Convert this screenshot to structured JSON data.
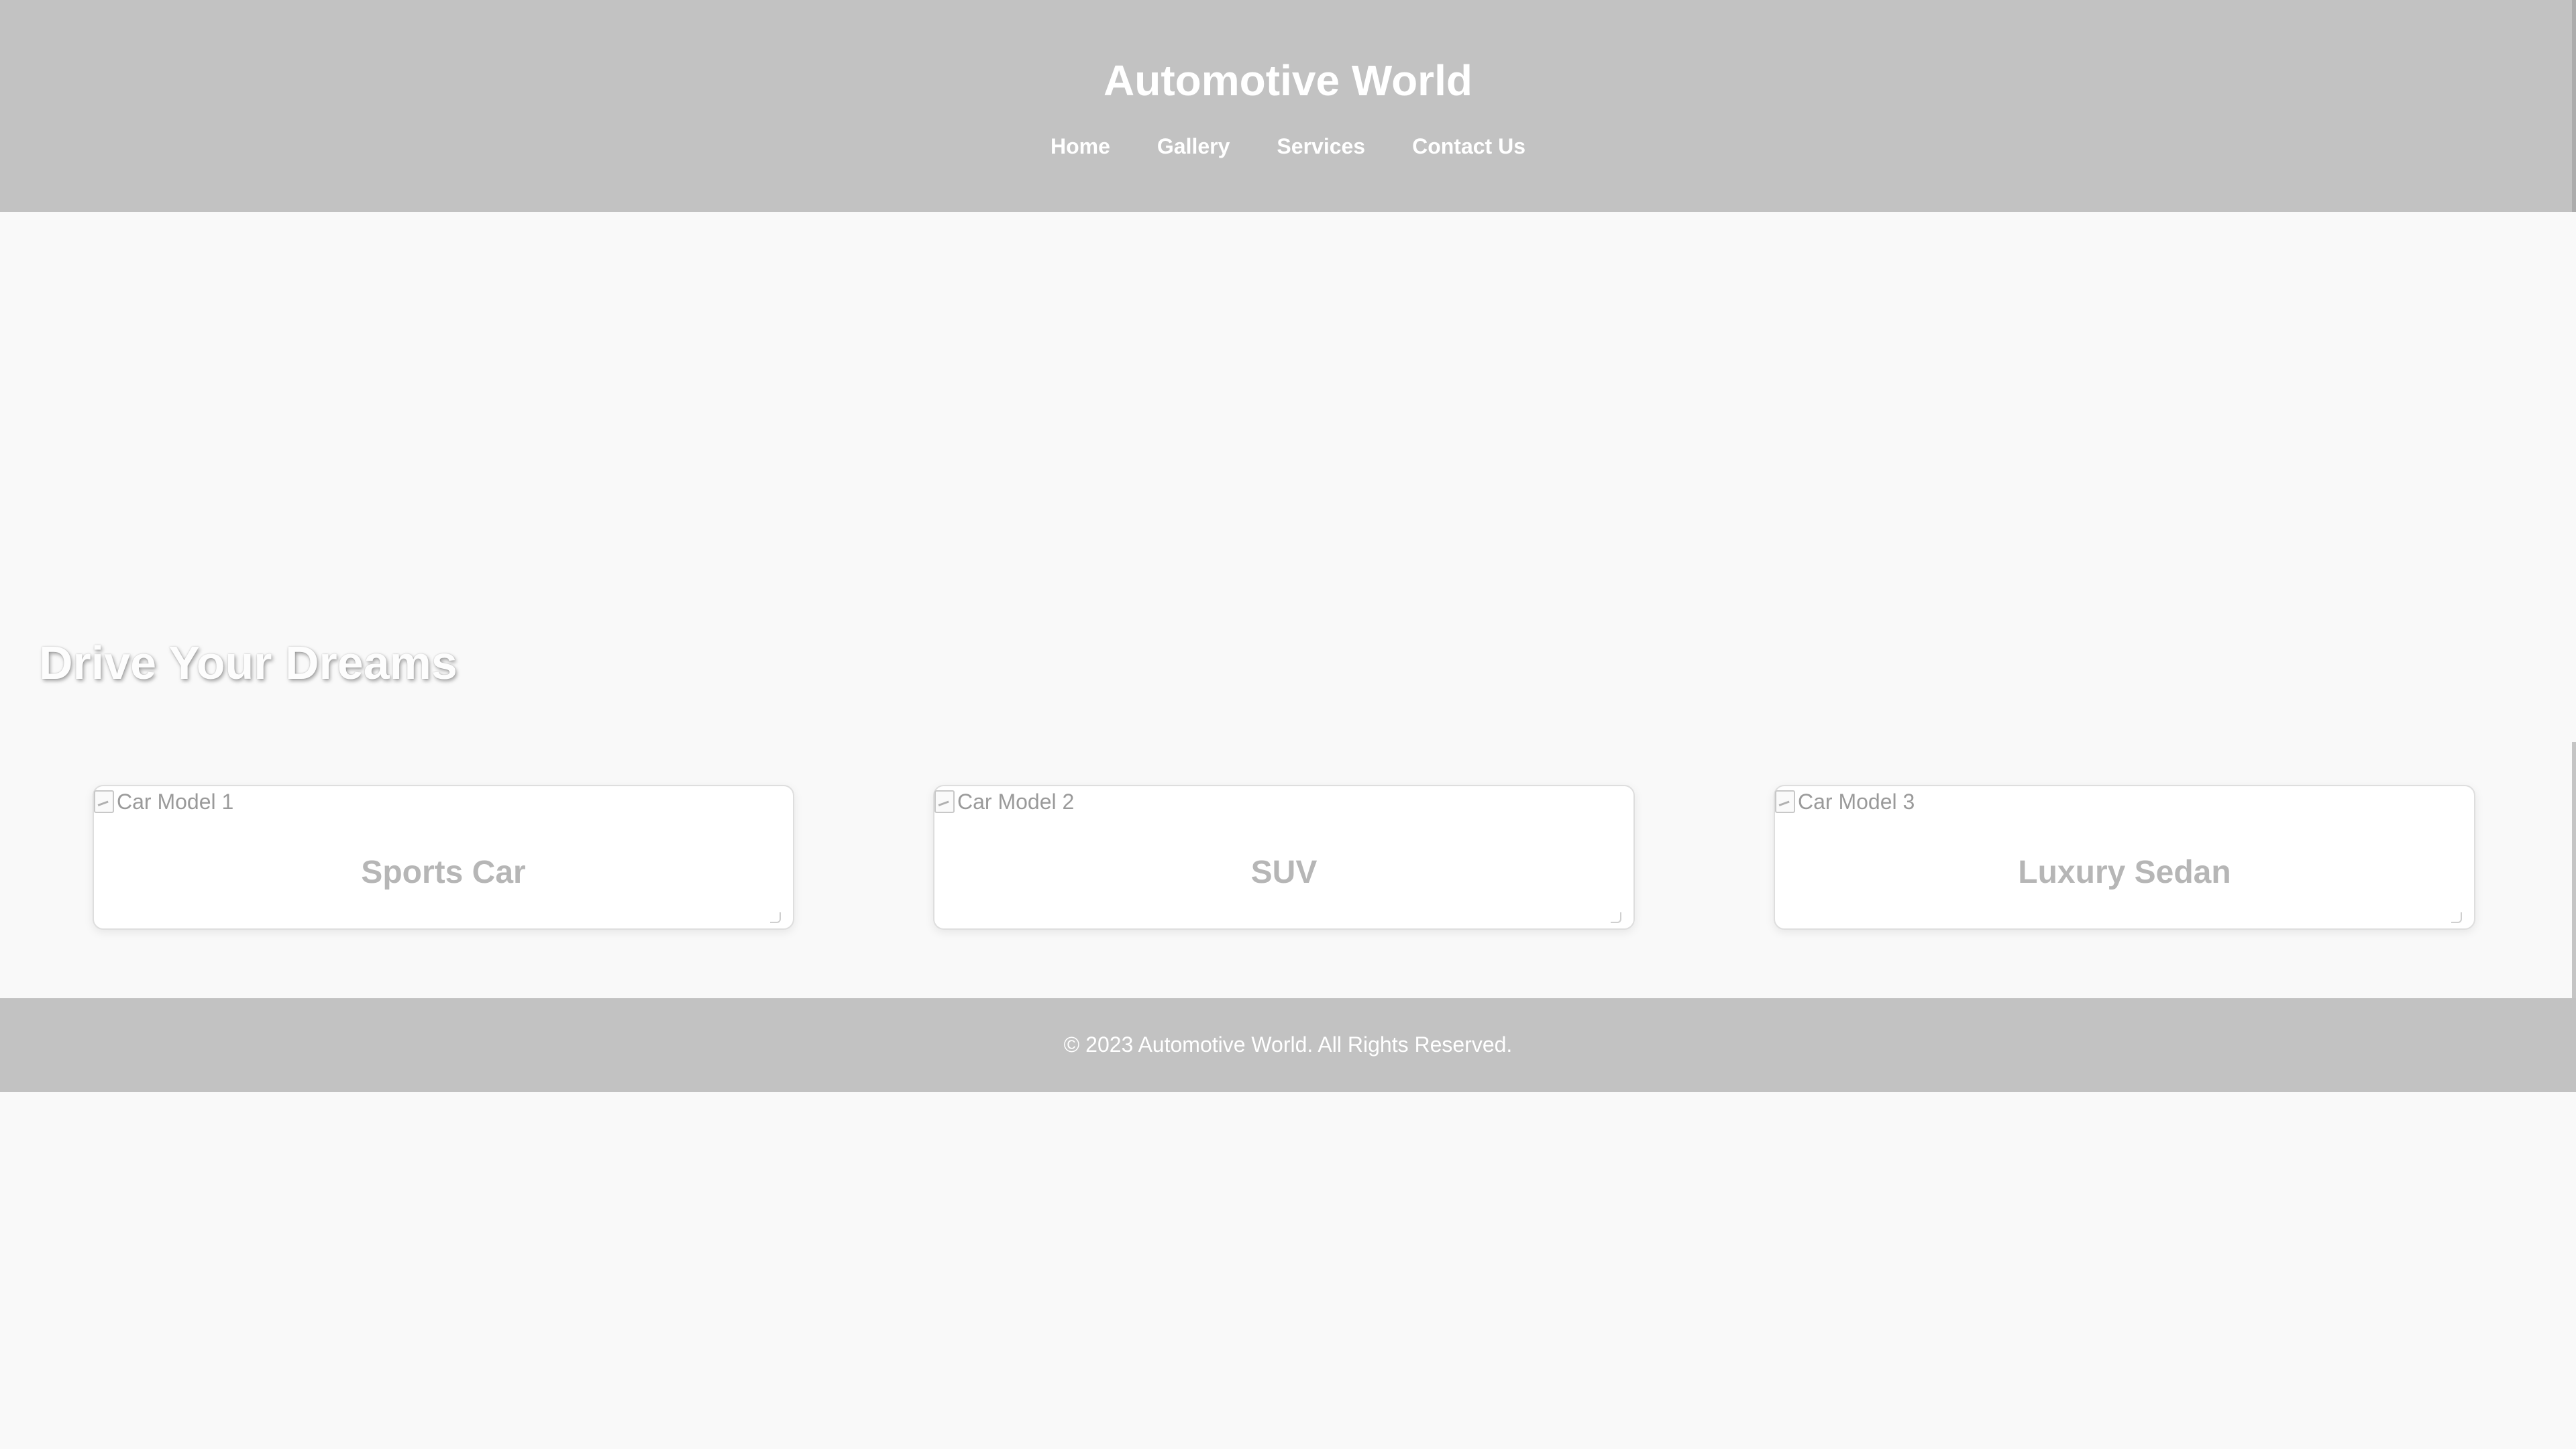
{
  "header": {
    "title": "Automotive World",
    "nav": [
      {
        "label": "Home"
      },
      {
        "label": "Gallery"
      },
      {
        "label": "Services"
      },
      {
        "label": "Contact Us"
      }
    ]
  },
  "hero": {
    "heading": "Drive Your Dreams"
  },
  "gallery": {
    "cards": [
      {
        "image_alt": "Car Model 1",
        "title": "Sports Car"
      },
      {
        "image_alt": "Car Model 2",
        "title": "SUV"
      },
      {
        "image_alt": "Car Model 3",
        "title": "Luxury Sedan"
      }
    ]
  },
  "footer": {
    "text": "© 2023 Automotive World. All Rights Reserved."
  },
  "colors": {
    "header_background": "#c2c2c2",
    "page_background": "#f9f9f9",
    "header_text": "#ffffff",
    "card_title": "#b6b6b6"
  }
}
